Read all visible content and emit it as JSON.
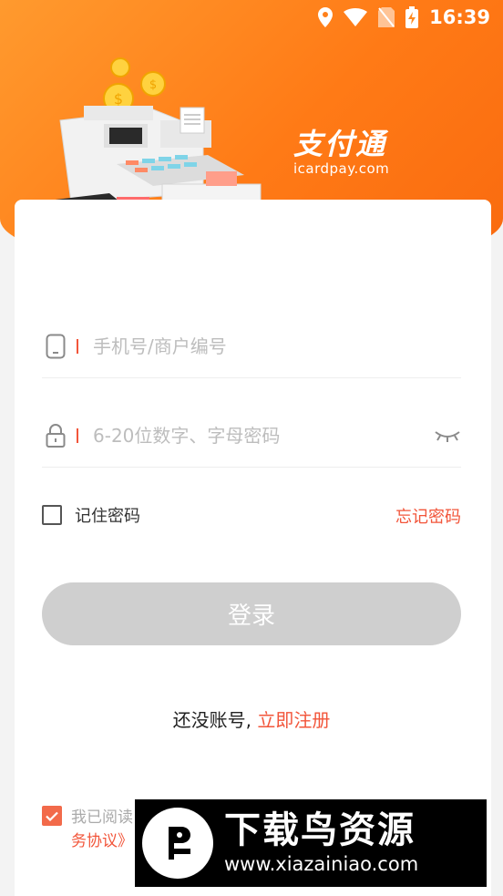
{
  "status_bar": {
    "time": "16:39"
  },
  "brand": {
    "name_cn": "支付通",
    "domain": "icardpay.com"
  },
  "login_form": {
    "phone_placeholder": "手机号/商户编号",
    "password_placeholder": "6-20位数字、字母密码",
    "remember_label": "记住密码",
    "forgot_label": "忘记密码",
    "login_label": "登录"
  },
  "register": {
    "prompt": "还没账号, ",
    "link_label": "立即注册"
  },
  "agreement": {
    "prefix": "我已阅读",
    "link_tail": "务协议》"
  },
  "watermark": {
    "title": "下载鸟资源",
    "url": "www.xiazainiao.com"
  },
  "colors": {
    "accent": "#f2553a",
    "header": "#ff8a1f",
    "button_disabled": "#cfcfcf"
  }
}
